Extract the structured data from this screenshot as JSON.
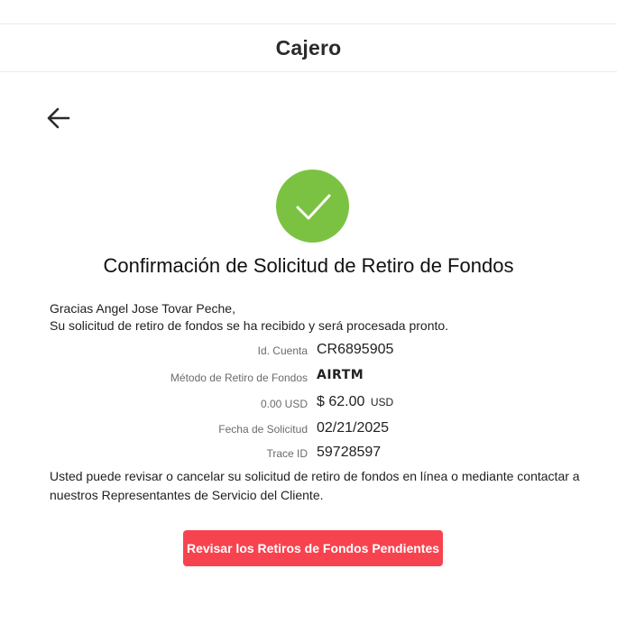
{
  "header": {
    "title": "Cajero"
  },
  "icons": {
    "back": "arrow-left-icon",
    "success": "checkmark-icon"
  },
  "colors": {
    "success": "#7cc242",
    "primary_button": "#f7434f"
  },
  "confirmation": {
    "title": "Confirmación de Solicitud de Retiro de Fondos",
    "greeting_line": "Gracias Angel Jose Tovar Peche,",
    "message_line": "Su solicitud de retiro de fondos se ha recibido y será procesada pronto."
  },
  "details": {
    "account_label": "Id. Cuenta",
    "account_value": "CR6895905",
    "method_label": "Método de Retiro de Fondos",
    "method_value": "AIRTM",
    "fee_label": "0.00 USD",
    "amount_value": "$ 62.00",
    "amount_currency": "USD",
    "date_label": "Fecha de Solicitud",
    "date_value": "02/21/2025",
    "trace_label": "Trace ID",
    "trace_value": "59728597"
  },
  "footer": {
    "text": "Usted puede revisar o cancelar su solicitud de retiro de fondos en línea o mediante contactar a nuestros Representantes de Servicio del Cliente."
  },
  "actions": {
    "review_button": "Revisar los Retiros de Fondos Pendientes"
  }
}
